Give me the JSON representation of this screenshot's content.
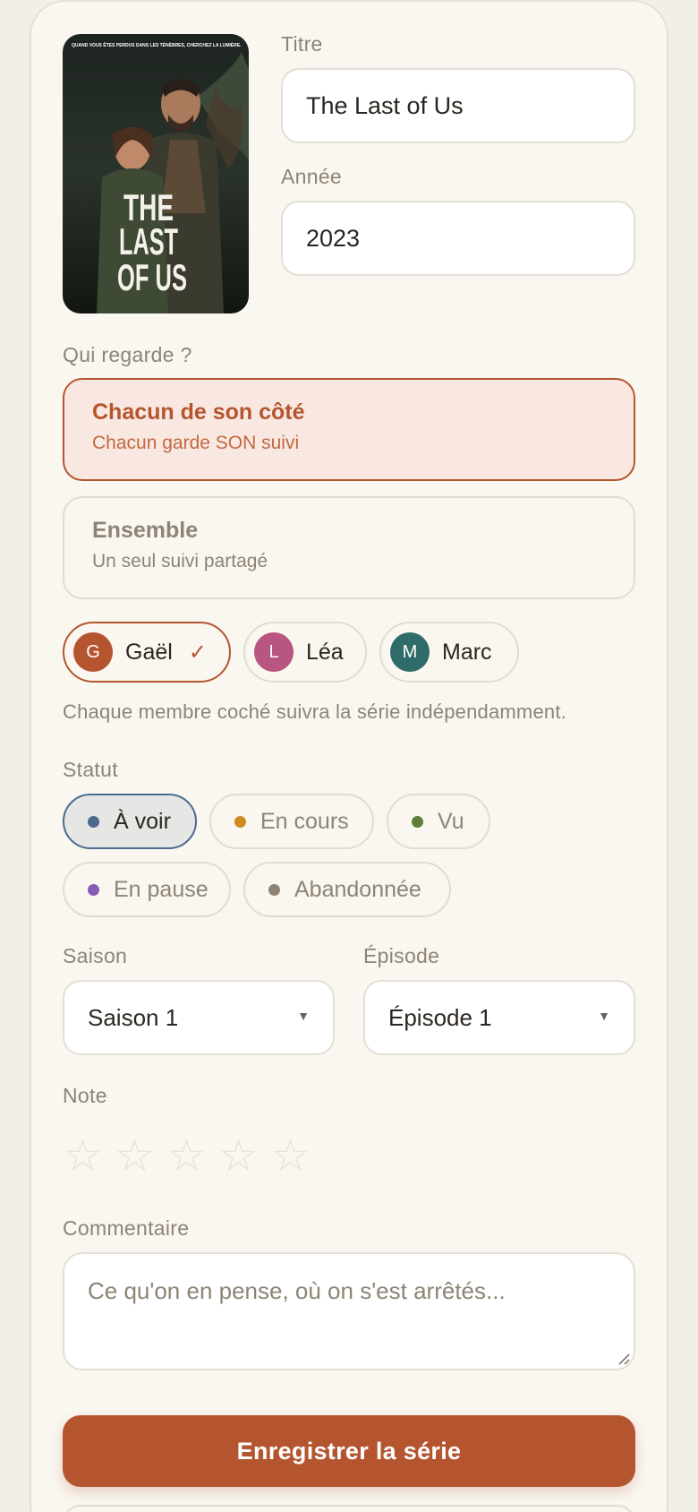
{
  "form": {
    "title_label": "Titre",
    "title_value": "The Last of Us",
    "year_label": "Année",
    "year_value": "2023",
    "poster": {
      "tagline": "QUAND VOUS ÊTES PERDUS DANS LES TÉNÈBRES, CHERCHEZ LA LUMIÈRE.",
      "title_lines": [
        "THE",
        "LAST",
        "OF US"
      ]
    },
    "watch_label": "Qui regarde ?",
    "modes": [
      {
        "title": "Chacun de son côté",
        "subtitle": "Chacun garde SON suivi",
        "selected": true
      },
      {
        "title": "Ensemble",
        "subtitle": "Un seul suivi partagé",
        "selected": false
      }
    ],
    "members": [
      {
        "initial": "G",
        "name": "Gaël",
        "color": "#b5552f",
        "checked": true,
        "check_icon": "✓"
      },
      {
        "initial": "L",
        "name": "Léa",
        "color": "#b85580",
        "checked": false
      },
      {
        "initial": "M",
        "name": "Marc",
        "color": "#2f6b68",
        "checked": false
      }
    ],
    "members_help": "Chaque membre coché suivra la série indépendamment.",
    "status_label": "Statut",
    "statuses": [
      {
        "label": "À voir",
        "color": "#4b6a8f",
        "selected": true
      },
      {
        "label": "En cours",
        "color": "#d08a1e",
        "selected": false
      },
      {
        "label": "Vu",
        "color": "#5b7f3a",
        "selected": false
      },
      {
        "label": "En pause",
        "color": "#8a5bb5",
        "selected": false
      },
      {
        "label": "Abandonnée",
        "color": "#8d8475",
        "selected": false
      }
    ],
    "season_label": "Saison",
    "season_value": "Saison 1",
    "episode_label": "Épisode",
    "episode_value": "Épisode 1",
    "rating_label": "Note",
    "rating_value": 0,
    "rating_max": 5,
    "comment_label": "Commentaire",
    "comment_placeholder": "Ce qu'on en pense, où on s'est arrêtés...",
    "submit_label": "Enregistrer la série"
  },
  "colors": {
    "accent": "#b5552f",
    "background": "#f2efe7",
    "card": "#faf7f1"
  }
}
